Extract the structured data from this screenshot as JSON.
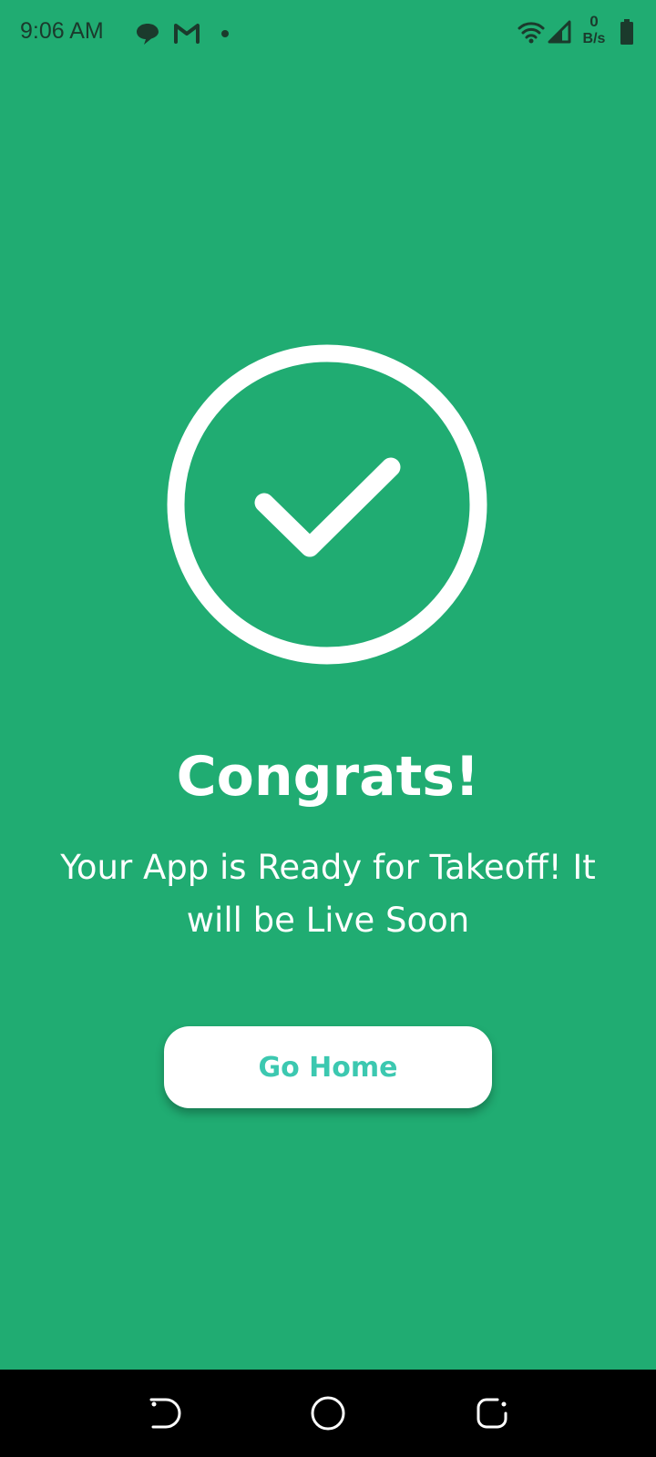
{
  "colors": {
    "background": "#20AC72",
    "accent_text": "#3CC8B0",
    "nav_bar": "#000000"
  },
  "status_bar": {
    "time": "9:06 AM",
    "net_speed_value": "0",
    "net_speed_unit": "B/s",
    "icons": [
      "chat-bubble-icon",
      "gmail-icon",
      "notification-dot-icon",
      "wifi-icon",
      "cell-signal-icon",
      "battery-icon"
    ]
  },
  "main": {
    "success_icon": "check-circle-icon",
    "title": "Congrats!",
    "message": "Your App is Ready for Takeoff! It will be Live Soon",
    "button_label": "Go Home"
  },
  "nav_bar": {
    "buttons": [
      "back-icon",
      "home-icon",
      "recents-icon"
    ]
  }
}
